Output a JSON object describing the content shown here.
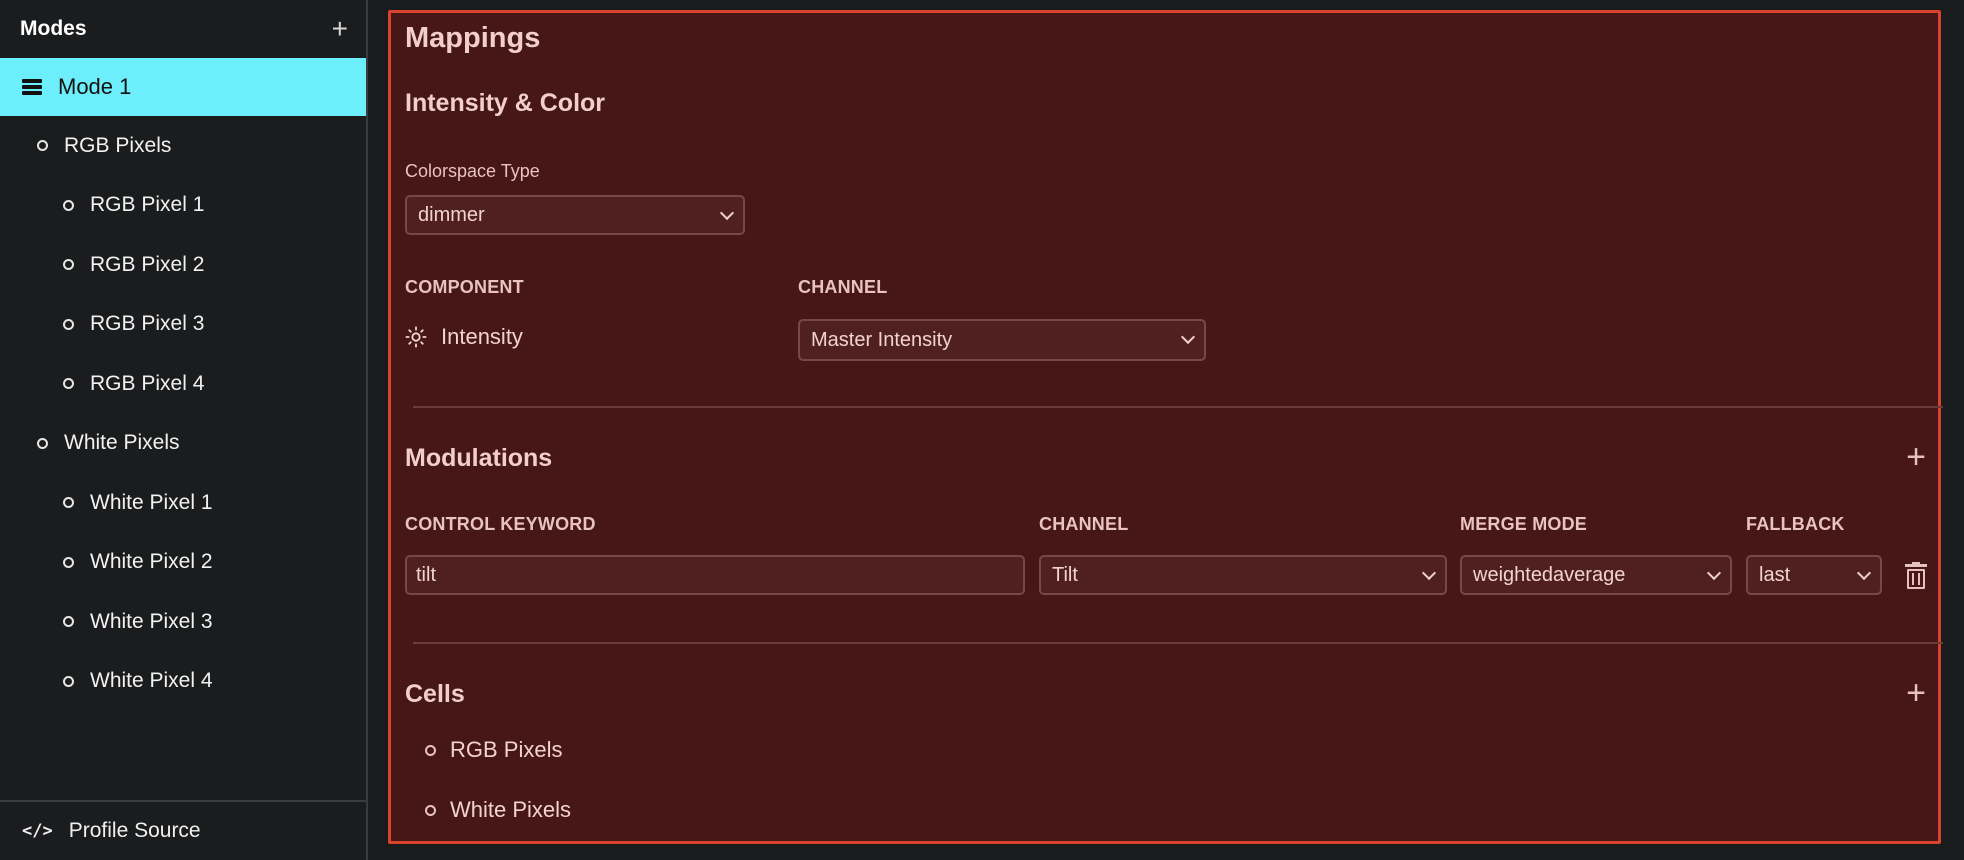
{
  "sidebar": {
    "title": "Modes",
    "add_icon": "plus-icon",
    "mode": {
      "label": "Mode 1",
      "icon": "list-icon"
    },
    "items": [
      {
        "label": "RGB Pixels",
        "level": 1
      },
      {
        "label": "RGB Pixel 1",
        "level": 2
      },
      {
        "label": "RGB Pixel 2",
        "level": 2
      },
      {
        "label": "RGB Pixel 3",
        "level": 2
      },
      {
        "label": "RGB Pixel 4",
        "level": 2
      },
      {
        "label": "White Pixels",
        "level": 1
      },
      {
        "label": "White Pixel 1",
        "level": 2
      },
      {
        "label": "White Pixel 2",
        "level": 2
      },
      {
        "label": "White Pixel 3",
        "level": 2
      },
      {
        "label": "White Pixel 4",
        "level": 2
      }
    ],
    "footer": {
      "label": "Profile Source",
      "icon": "code-icon"
    }
  },
  "main": {
    "title": "Mappings",
    "intensity": {
      "heading": "Intensity & Color",
      "colorspace_label": "Colorspace Type",
      "colorspace_value": "dimmer",
      "component_header": "COMPONENT",
      "channel_header": "CHANNEL",
      "component": "Intensity",
      "channel_value": "Master Intensity"
    },
    "modulations": {
      "heading": "Modulations",
      "headers": {
        "keyword": "CONTROL KEYWORD",
        "channel": "CHANNEL",
        "merge": "MERGE MODE",
        "fallback": "FALLBACK"
      },
      "row": {
        "keyword": "tilt",
        "channel": "Tilt",
        "merge": "weightedaverage",
        "fallback": "last"
      }
    },
    "cells": {
      "heading": "Cells",
      "items": [
        "RGB Pixels",
        "White Pixels"
      ]
    }
  },
  "colors": {
    "accent": "#6deefb",
    "panel_bg": "#461716",
    "panel_border": "#d9422c"
  }
}
